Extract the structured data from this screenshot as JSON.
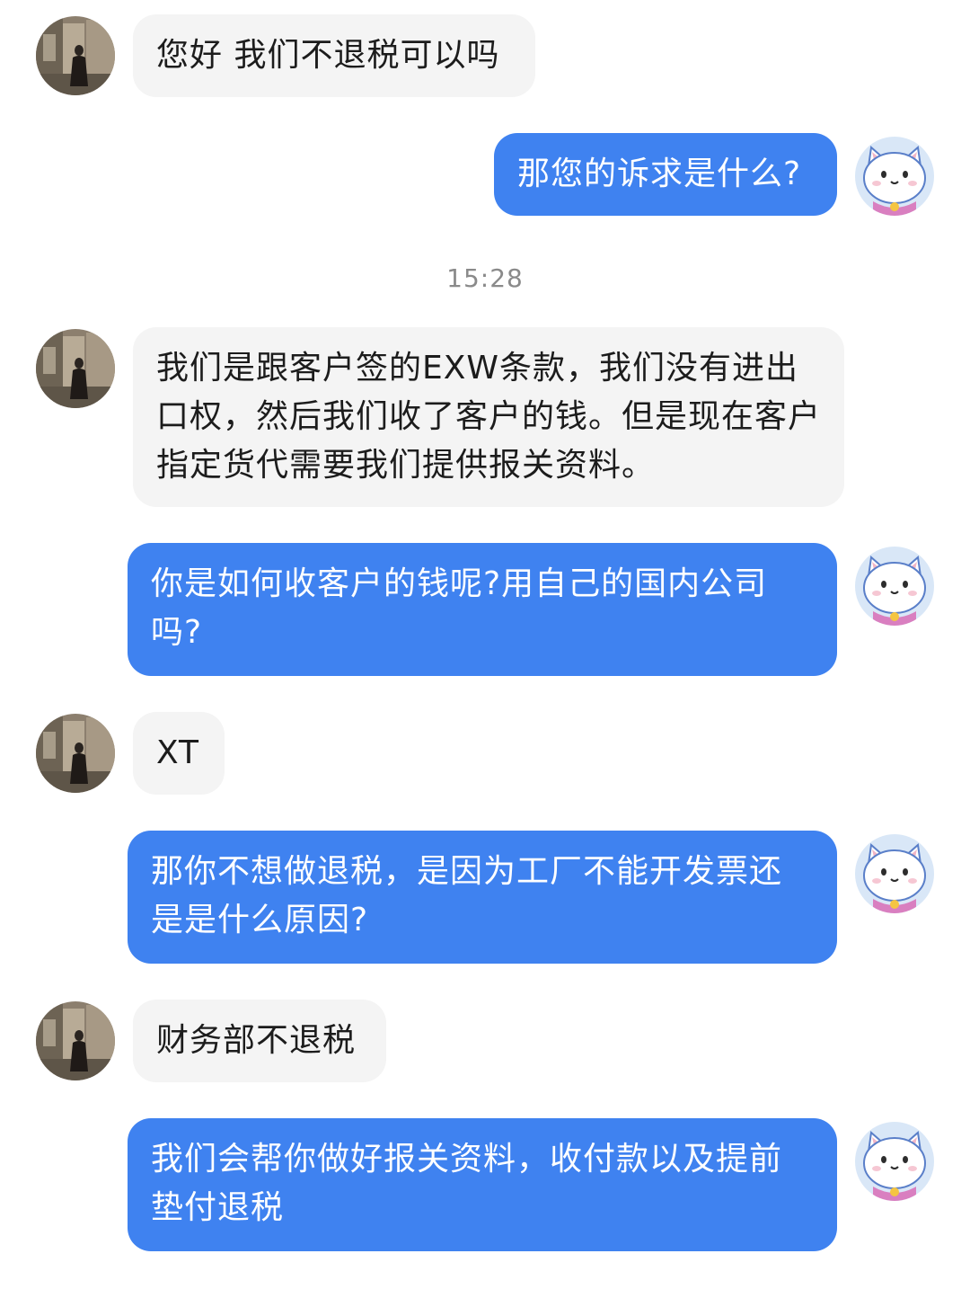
{
  "messages": [
    {
      "sender": "other",
      "text": "您好 我们不退税可以吗"
    },
    {
      "sender": "me",
      "text": "那您的诉求是什么?"
    },
    {
      "sender": "other",
      "text": "我们是跟客户签的EXW条款，我们没有进出口权，然后我们收了客户的钱。但是现在客户指定货代需要我们提供报关资料。"
    },
    {
      "sender": "me",
      "text": "你是如何收客户的钱呢?用自己的国内公司吗?"
    },
    {
      "sender": "other",
      "text": "XT"
    },
    {
      "sender": "me",
      "text": "那你不想做退税，是因为工厂不能开发票还是是什么原因?"
    },
    {
      "sender": "other",
      "text": "财务部不退税"
    },
    {
      "sender": "me",
      "text": "我们会帮你做好报关资料，收付款以及提前垫付退税"
    }
  ],
  "timestamp": "15:28",
  "colors": {
    "outgoing_bubble": "#3f82f0",
    "incoming_bubble": "#f4f4f4",
    "timestamp_text": "#8a8a8a"
  },
  "icons": {
    "other_avatar": "photo-avatar",
    "me_avatar": "cartoon-cat-avatar"
  }
}
